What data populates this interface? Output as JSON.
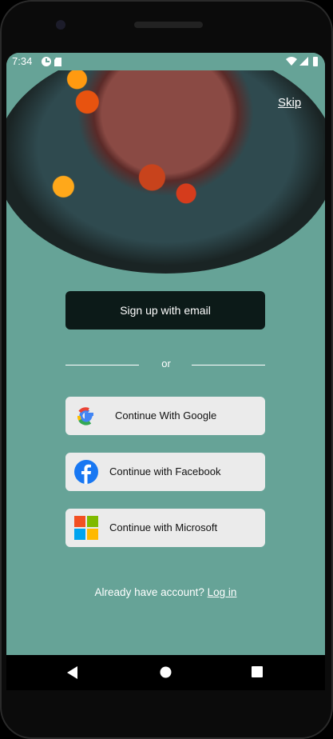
{
  "status": {
    "time": "7:34"
  },
  "header": {
    "skip_label": "Skip"
  },
  "main": {
    "signup_email_label": "Sign up with email",
    "divider_label": "or",
    "social_buttons": [
      {
        "label": "Continue With Google",
        "icon": "google-icon"
      },
      {
        "label": "Continue with Facebook",
        "icon": "facebook-icon"
      },
      {
        "label": "Continue with Microsoft",
        "icon": "microsoft-icon"
      }
    ],
    "footer_text": "Already have account?",
    "login_label": "Log in"
  },
  "colors": {
    "background": "#66A397",
    "primary_button": "#0C1A18",
    "social_button": "#EBEBEB"
  }
}
